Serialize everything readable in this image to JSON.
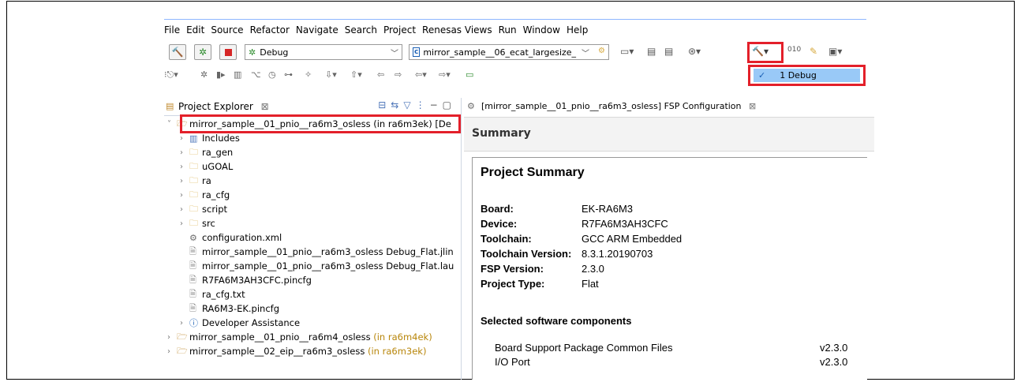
{
  "menu": [
    "File",
    "Edit",
    "Source",
    "Refactor",
    "Navigate",
    "Search",
    "Project",
    "Renesas Views",
    "Run",
    "Window",
    "Help"
  ],
  "toolbar": {
    "build_config": "Debug",
    "launch_config": "mirror_sample__06_ecat_largesize_"
  },
  "build_dropdown": {
    "item": "1 Debug",
    "checked": true
  },
  "project_explorer": {
    "title": "Project Explorer",
    "tab_close": "⊠",
    "items": [
      {
        "label": "mirror_sample__01_pnio__ra6m3_osless",
        "suffix": "(in ra6m3ek) [De",
        "icon": "project-icon",
        "level": 0
      },
      {
        "label": "Includes",
        "icon": "includes-icon",
        "level": 1
      },
      {
        "label": "ra_gen",
        "icon": "source-folder-icon",
        "level": 1
      },
      {
        "label": "uGOAL",
        "icon": "package-folder-icon",
        "level": 1
      },
      {
        "label": "ra",
        "icon": "folder-icon",
        "level": 1
      },
      {
        "label": "ra_cfg",
        "icon": "folder-icon",
        "level": 1
      },
      {
        "label": "script",
        "icon": "folder-icon",
        "level": 1
      },
      {
        "label": "src",
        "icon": "folder-icon",
        "level": 1
      },
      {
        "label": "configuration.xml",
        "icon": "config-icon",
        "level": 1
      },
      {
        "label": "mirror_sample__01_pnio__ra6m3_osless Debug_Flat.jlin",
        "icon": "file-icon",
        "level": 1
      },
      {
        "label": "mirror_sample__01_pnio__ra6m3_osless Debug_Flat.lau",
        "icon": "file-icon",
        "level": 1
      },
      {
        "label": "R7FA6M3AH3CFC.pincfg",
        "icon": "file-icon",
        "level": 1
      },
      {
        "label": "ra_cfg.txt",
        "icon": "file-icon",
        "level": 1
      },
      {
        "label": "RA6M3-EK.pincfg",
        "icon": "file-icon",
        "level": 1
      },
      {
        "label": "Developer Assistance",
        "icon": "help-icon",
        "level": 1
      },
      {
        "label": "mirror_sample__01_pnio__ra6m4_osless",
        "suffix": "(in ra6m4ek)",
        "icon": "project-icon",
        "level": 0
      },
      {
        "label": "mirror_sample__02_eip__ra6m3_osless",
        "suffix": "(in ra6m3ek)",
        "icon": "project-icon",
        "level": 0
      }
    ]
  },
  "editor": {
    "tab_title": "[mirror_sample__01_pnio__ra6m3_osless] FSP Configuration",
    "tab_close": "⊠",
    "header": "Summary",
    "panel_title": "Project Summary",
    "fields": [
      {
        "key": "Board:",
        "value": "EK-RA6M3"
      },
      {
        "key": "Device:",
        "value": "R7FA6M3AH3CFC"
      },
      {
        "key": "Toolchain:",
        "value": "GCC ARM Embedded"
      },
      {
        "key": "Toolchain Version:",
        "value": "8.3.1.20190703"
      },
      {
        "key": "FSP Version:",
        "value": "2.3.0"
      },
      {
        "key": "Project Type:",
        "value": "Flat"
      }
    ],
    "components_title": "Selected software components",
    "components": [
      {
        "name": "Board Support Package Common Files",
        "version": "v2.3.0"
      },
      {
        "name": "I/O Port",
        "version": "v2.3.0"
      }
    ]
  },
  "colors": {
    "highlight": "#e3202a",
    "selection": "#99c9f7"
  }
}
